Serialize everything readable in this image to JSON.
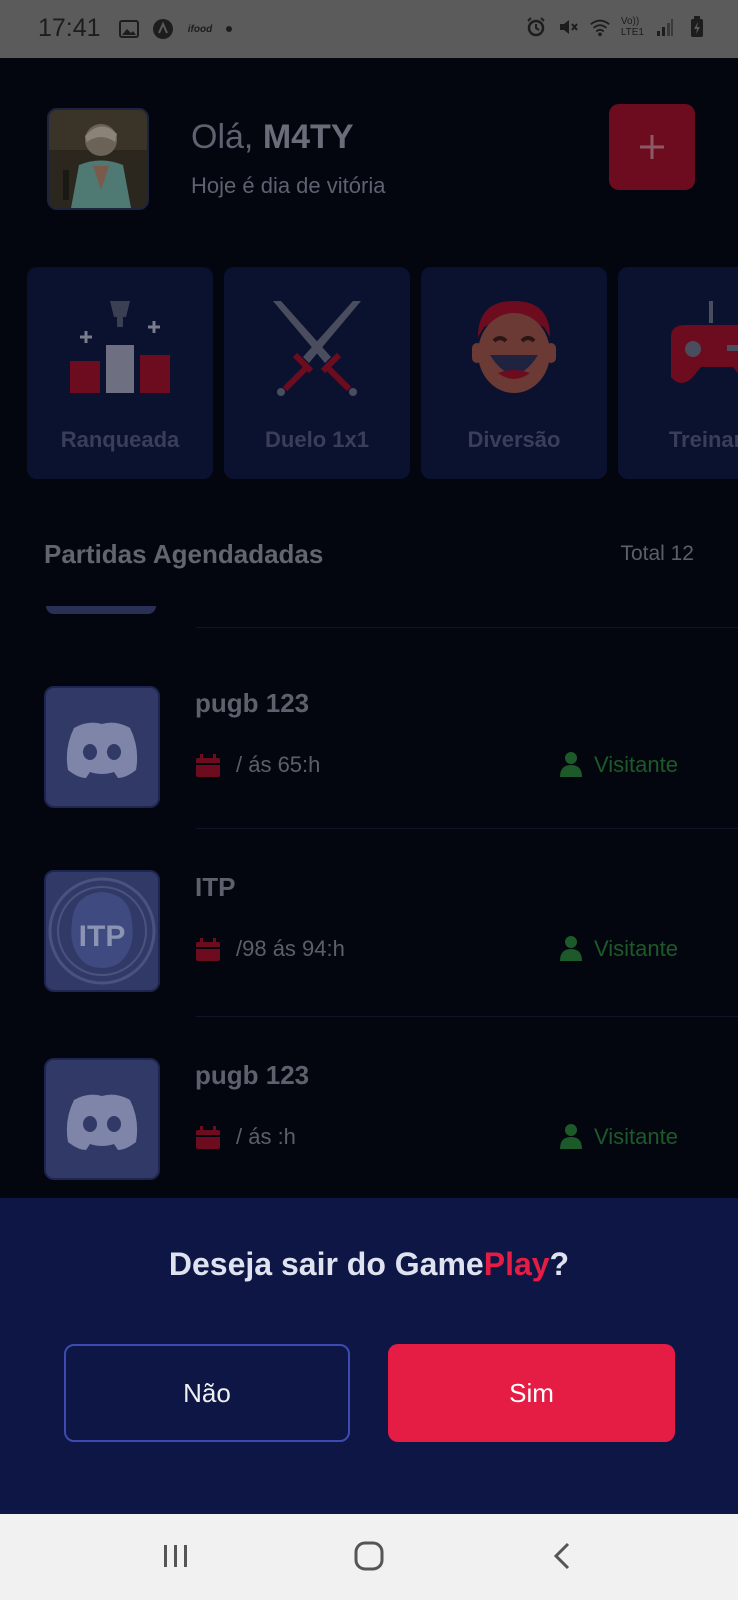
{
  "status_bar": {
    "time": "17:41",
    "left_icons": [
      "image-icon",
      "app-a-icon",
      "ifood-icon",
      "dot-icon"
    ],
    "right_icons": [
      "alarm-icon",
      "mute-icon",
      "wifi-icon",
      "lte-icon",
      "signal-icon",
      "battery-icon"
    ],
    "network_label_top": "Vo))",
    "network_label_bottom": "LTE1"
  },
  "header": {
    "greeting_prefix": "Olá,",
    "username": "M4TY",
    "subtitle": "Hoje é dia de vitória",
    "add_button_icon": "plus-icon"
  },
  "categories": [
    {
      "label": "Ranqueada",
      "icon": "ranking-icon"
    },
    {
      "label": "Duelo 1x1",
      "icon": "swords-icon"
    },
    {
      "label": "Diversão",
      "icon": "laughing-face-icon"
    },
    {
      "label": "Treinam",
      "icon": "gamepad-icon"
    }
  ],
  "section": {
    "title": "Partidas Agendadadas",
    "total": "Total 12"
  },
  "matches": [
    {
      "title": "pugb 123",
      "date": "/ ás 65:h",
      "role": "Visitante",
      "thumb": "discord-icon"
    },
    {
      "title": "ITP",
      "date": "/98 ás 94:h",
      "role": "Visitante",
      "thumb": "itp-logo",
      "thumb_text": "ITP"
    },
    {
      "title": "pugb 123",
      "date": "/ ás :h",
      "role": "Visitante",
      "thumb": "discord-icon"
    }
  ],
  "modal": {
    "title_prefix": "Deseja sair do Game",
    "title_accent": "Play",
    "title_suffix": "?",
    "no_label": "Não",
    "yes_label": "Sim"
  },
  "colors": {
    "accent": "#e51c44",
    "modal_bg": "#0e1646",
    "role_green": "#1c5a2a"
  },
  "navbar": {
    "icons": [
      "recent-apps-icon",
      "home-icon",
      "back-icon"
    ]
  }
}
